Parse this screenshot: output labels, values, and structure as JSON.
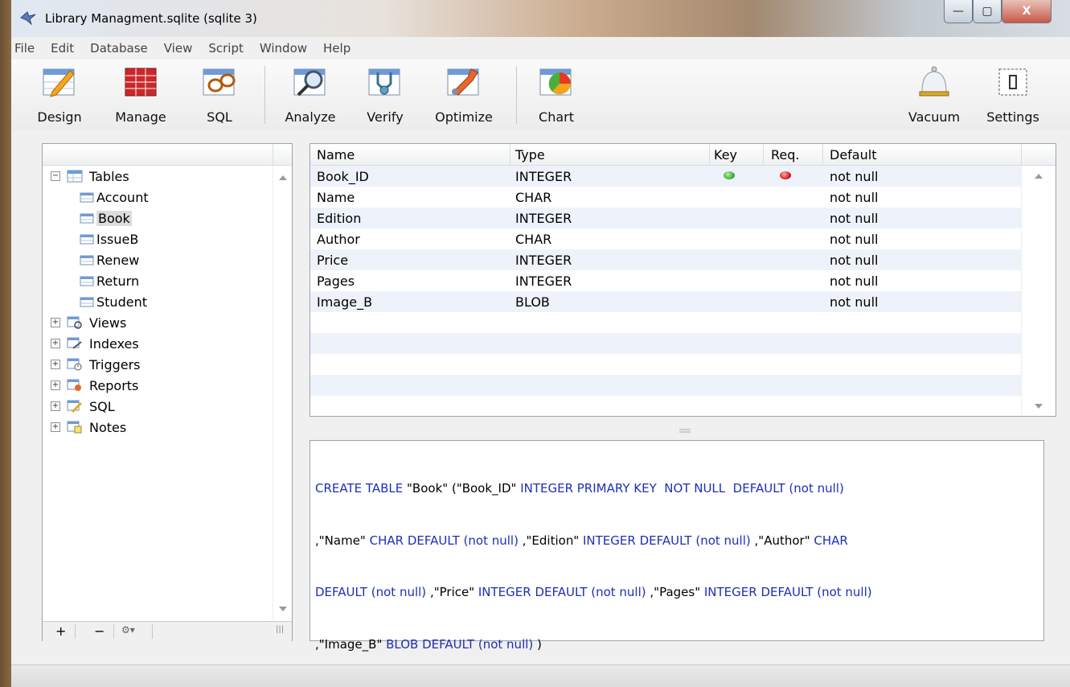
{
  "window": {
    "title": "Library Managment.sqlite (sqlite 3)",
    "controls": {
      "minimize": "—",
      "maximize": "▢",
      "close": "X"
    }
  },
  "menu": [
    "File",
    "Edit",
    "Database",
    "View",
    "Script",
    "Window",
    "Help"
  ],
  "toolbar": {
    "design": "Design",
    "manage": "Manage",
    "sql": "SQL",
    "analyze": "Analyze",
    "verify": "Verify",
    "optimize": "Optimize",
    "chart": "Chart",
    "vacuum": "Vacuum",
    "settings": "Settings"
  },
  "tree": {
    "tables_label": "Tables",
    "tables": [
      "Account",
      "Book",
      "IssueB",
      "Renew",
      "Return",
      "Student"
    ],
    "selected_table": "Book",
    "groups": [
      "Views",
      "Indexes",
      "Triggers",
      "Reports",
      "SQL",
      "Notes"
    ],
    "footer": {
      "add": "+",
      "remove": "−",
      "gear": "⚙▾",
      "grip": "|||"
    }
  },
  "grid": {
    "headers": {
      "name": "Name",
      "type": "Type",
      "key": "Key",
      "req": "Req.",
      "default": "Default"
    },
    "rows": [
      {
        "name": "Book_ID",
        "type": "INTEGER",
        "default": "not null",
        "key": true,
        "req": true
      },
      {
        "name": "Name",
        "type": "CHAR",
        "default": "not null",
        "key": false,
        "req": false
      },
      {
        "name": "Edition",
        "type": "INTEGER",
        "default": "not null",
        "key": false,
        "req": false
      },
      {
        "name": "Author",
        "type": "CHAR",
        "default": "not null",
        "key": false,
        "req": false
      },
      {
        "name": "Price",
        "type": "INTEGER",
        "default": "not null",
        "key": false,
        "req": false
      },
      {
        "name": "Pages",
        "type": "INTEGER",
        "default": "not null",
        "key": false,
        "req": false
      },
      {
        "name": "Image_B",
        "type": "BLOB",
        "default": "not null",
        "key": false,
        "req": false
      }
    ],
    "colors": {
      "key": "#3fb33f",
      "req": "#d81e1e",
      "alt_row": "#eef3fb"
    }
  },
  "sql": {
    "lines": [
      "CREATE TABLE \"Book\" (\"Book_ID\" INTEGER PRIMARY KEY  NOT NULL  DEFAULT (not null)",
      ",\"Name\" CHAR DEFAULT (not null) ,\"Edition\" INTEGER DEFAULT (not null) ,\"Author\" CHAR",
      "DEFAULT (not null) ,\"Price\" INTEGER DEFAULT (not null) ,\"Pages\" INTEGER DEFAULT (not null)",
      ",\"Image_B\" BLOB DEFAULT (not null) )"
    ],
    "colors": {
      "keyword": "#1e2fb6",
      "identifier": "#000000"
    }
  }
}
